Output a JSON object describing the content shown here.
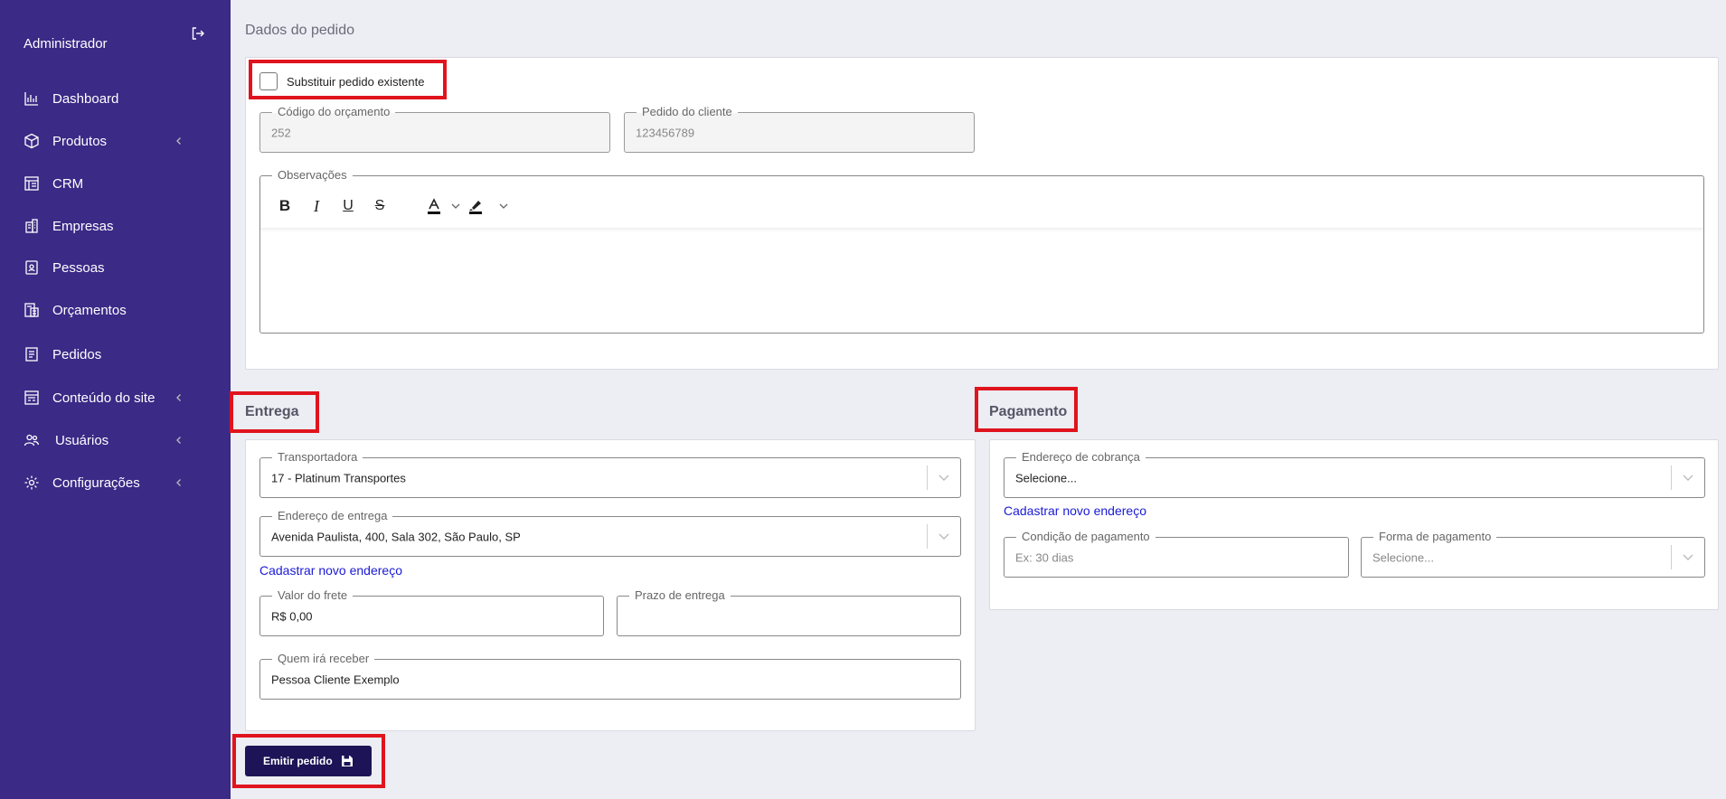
{
  "sidebar": {
    "user_name": "Administrador",
    "items": [
      {
        "label": "Dashboard",
        "icon": "bar-chart-icon",
        "has_submenu": false
      },
      {
        "label": "Produtos",
        "icon": "box-icon",
        "has_submenu": true
      },
      {
        "label": "CRM",
        "icon": "crm-board-icon",
        "has_submenu": false
      },
      {
        "label": "Empresas",
        "icon": "building-icon",
        "has_submenu": false
      },
      {
        "label": "Pessoas",
        "icon": "person-badge-icon",
        "has_submenu": false
      },
      {
        "label": "Orçamentos",
        "icon": "calculator-doc-icon",
        "has_submenu": false
      },
      {
        "label": "Pedidos",
        "icon": "receipt-icon",
        "has_submenu": false
      },
      {
        "label": "Conteúdo do site",
        "icon": "web-content-icon",
        "has_submenu": true
      },
      {
        "label": "Usuários",
        "icon": "users-icon",
        "has_submenu": true
      },
      {
        "label": "Configurações",
        "icon": "gear-icon",
        "has_submenu": true
      }
    ]
  },
  "pedido": {
    "section_title": "Dados do pedido",
    "substituir_label": "Substituir pedido existente",
    "substituir_checked": false,
    "codigo_orcamento": {
      "label": "Código do orçamento",
      "value": "252"
    },
    "pedido_cliente": {
      "label": "Pedido do cliente",
      "value": "123456789"
    },
    "observacoes": {
      "label": "Observações",
      "value": ""
    },
    "toolbar": [
      "bold-icon",
      "italic-icon",
      "underline-icon",
      "strikethrough-icon",
      "font-color-icon",
      "highlight-icon"
    ]
  },
  "entrega": {
    "section_title": "Entrega",
    "transportadora": {
      "label": "Transportadora",
      "value": "17 - Platinum Transportes"
    },
    "endereco_entrega": {
      "label": "Endereço de entrega",
      "value": "Avenida Paulista, 400, Sala 302, São Paulo, SP"
    },
    "cadastrar_link": "Cadastrar novo endereço",
    "valor_frete": {
      "label": "Valor do frete",
      "value": "R$ 0,00"
    },
    "prazo_entrega": {
      "label": "Prazo de entrega",
      "value": ""
    },
    "quem_recebe": {
      "label": "Quem irá receber",
      "value": "Pessoa Cliente Exemplo"
    }
  },
  "pagamento": {
    "section_title": "Pagamento",
    "endereco_cobranca": {
      "label": "Endereço de cobrança",
      "value": "Selecione..."
    },
    "cadastrar_link": "Cadastrar novo endereço",
    "condicao": {
      "label": "Condição de pagamento",
      "placeholder": "Ex: 30 dias"
    },
    "forma": {
      "label": "Forma de pagamento",
      "placeholder": "Selecione..."
    }
  },
  "actions": {
    "emitir_label": "Emitir pedido"
  },
  "colors": {
    "sidebar_bg": "#3b2a86",
    "primary_button": "#1c1456",
    "highlight_box": "#e0141e",
    "link": "#1a1ad6"
  }
}
